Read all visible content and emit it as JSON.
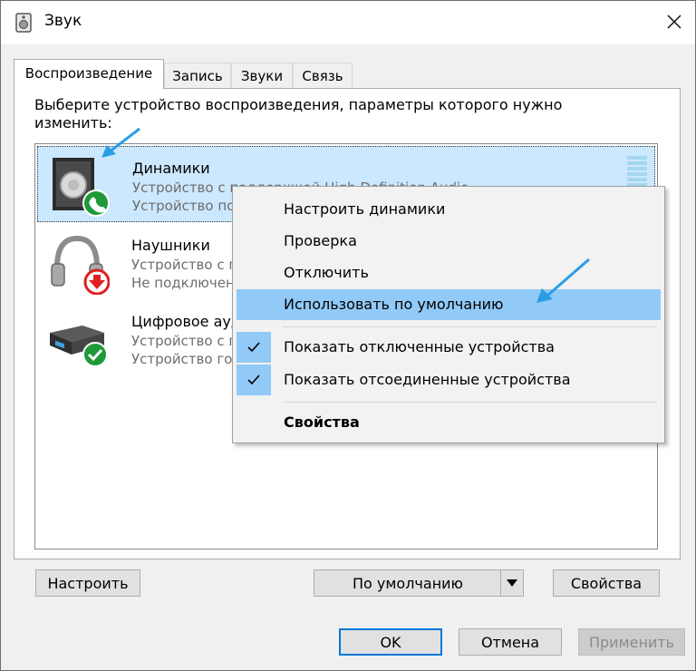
{
  "window": {
    "title": "Звук"
  },
  "tabs": [
    {
      "label": "Воспроизведение"
    },
    {
      "label": "Запись"
    },
    {
      "label": "Звуки"
    },
    {
      "label": "Связь"
    }
  ],
  "prompt": "Выберите устройство воспроизведения, параметры которого нужно изменить:",
  "devices": [
    {
      "name": "Динамики",
      "line1": "Устройство с поддержкой High Definition Audio",
      "line2": "Устройство по умолчанию",
      "icon": "speaker-icon",
      "status": "default-device"
    },
    {
      "name": "Наушники",
      "line1": "Устройство с поддержкой High Definition Audio",
      "line2": "Не подключено",
      "icon": "headphones-icon",
      "status": "disconnected"
    },
    {
      "name": "Цифровое аудио (S/PDIF)",
      "line1": "Устройство с поддержкой High Definition Audio",
      "line2": "Устройство готово",
      "icon": "digital-audio-icon",
      "status": "ready"
    }
  ],
  "context_menu": {
    "items": [
      {
        "label": "Настроить динамики"
      },
      {
        "label": "Проверка"
      },
      {
        "label": "Отключить"
      },
      {
        "label": "Использовать по умолчанию"
      },
      {
        "label": "Показать отключенные устройства",
        "checked": true
      },
      {
        "label": "Показать отсоединенные устройства",
        "checked": true
      },
      {
        "label": "Свойства"
      }
    ]
  },
  "panel_buttons": {
    "configure": "Настроить",
    "set_default": "По умолчанию",
    "properties": "Свойства"
  },
  "dialog_buttons": {
    "ok": "OK",
    "cancel": "Отмена",
    "apply": "Применить"
  },
  "colors": {
    "selection": "#cce8ff",
    "menu_highlight": "#91c9f7",
    "accent": "#0078d7",
    "arrow": "#2a9ee5",
    "status_green": "#1f9a3a",
    "status_red": "#e02020"
  }
}
